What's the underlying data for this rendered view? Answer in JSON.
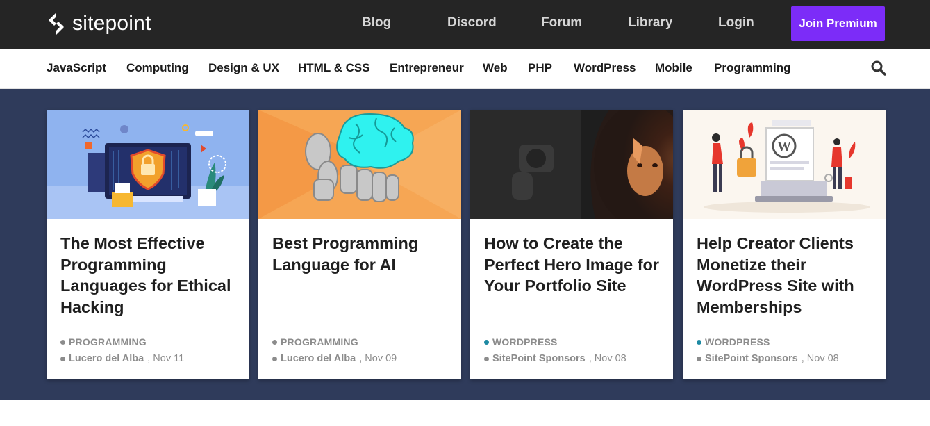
{
  "brand": {
    "name": "sitepoint"
  },
  "topnav": {
    "links": [
      "Blog",
      "Discord",
      "Forum",
      "Library",
      "Login"
    ],
    "premium_label": "Join Premium"
  },
  "categories": [
    "JavaScript",
    "Computing",
    "Design & UX",
    "HTML & CSS",
    "Entrepreneur",
    "Web",
    "PHP",
    "WordPress",
    "Mobile",
    "Programming"
  ],
  "colors": {
    "topbar": "#252525",
    "premium": "#7c2cf8",
    "band": "#2f3b5b",
    "category_dot_programming": "#8c8c8c",
    "category_dot_wordpress": "#1e8aa3"
  },
  "icons": {
    "search": "search-icon",
    "logo": "sitepoint-logo-icon"
  },
  "cards": [
    {
      "title": "The Most Effective Programming Languages for Ethical Hacking",
      "category": "PROGRAMMING",
      "author": "Lucero del Alba",
      "date": ", Nov 11"
    },
    {
      "title": "Best Programming Language for AI",
      "category": "PROGRAMMING",
      "author": "Lucero del Alba",
      "date": ", Nov 09"
    },
    {
      "title": "How to Create the Perfect Hero Image for Your Portfolio Site",
      "category": "WORDPRESS",
      "author": "SitePoint Sponsors",
      "date": ", Nov 08"
    },
    {
      "title": "Help Creator Clients Monetize their WordPress Site with Memberships",
      "category": "WORDPRESS",
      "author": "SitePoint Sponsors",
      "date": ", Nov 08"
    }
  ]
}
